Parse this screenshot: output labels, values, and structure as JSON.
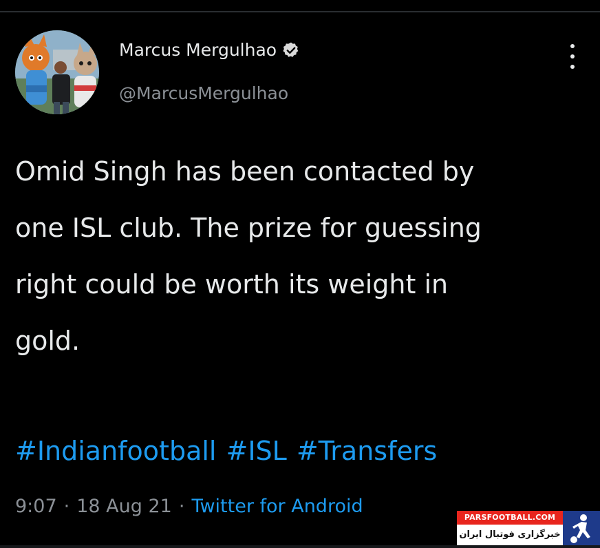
{
  "tweet": {
    "author": {
      "display_name": "Marcus Mergulhao",
      "handle": "@MarcusMergulhao",
      "verified": true
    },
    "text_lines": [
      "Omid Singh has been contacted by",
      "one ISL club. The prize for guessing",
      "right could be worth its weight in",
      "gold."
    ],
    "hashtags": [
      "#Indianfootball",
      "#ISL",
      "#Transfers"
    ],
    "meta": {
      "time": "9:07",
      "separator": "·",
      "date": "18 Aug 21",
      "source": "Twitter for Android"
    }
  },
  "watermark": {
    "site": "PARSFOOTBALL.COM",
    "tagline": "خبرگزاری فوتبال ایران"
  },
  "icons": {
    "verified": "verified-badge-icon",
    "more": "more-vertical-icon",
    "watermark_logo": "football-player-logo-icon"
  },
  "colors": {
    "background": "#000000",
    "text": "#e7e9ea",
    "secondary_text": "#8b9096",
    "link": "#1d9bf0",
    "watermark_red": "#e8251d",
    "watermark_blue": "#1e3a8a"
  }
}
